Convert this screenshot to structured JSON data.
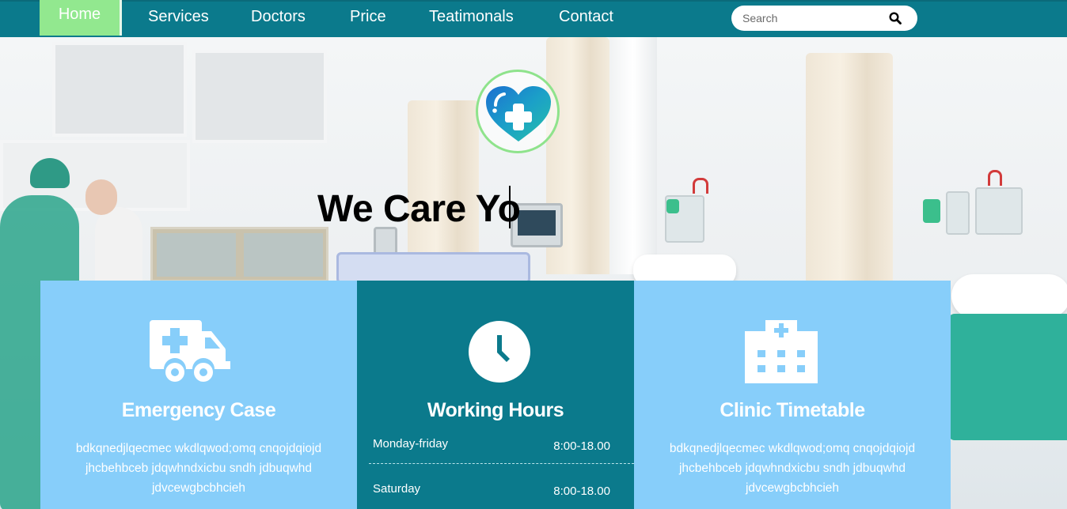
{
  "nav": {
    "items": [
      {
        "label": "Home"
      },
      {
        "label": "Services"
      },
      {
        "label": "Doctors"
      },
      {
        "label": "Price"
      },
      {
        "label": "Teatimonals"
      },
      {
        "label": "Contact"
      }
    ],
    "search_placeholder": "Search",
    "active_color": "#92e88f",
    "bar_color": "#0b7a8c"
  },
  "hero": {
    "heading": "We Care Yo",
    "logo_icon": "heart-plus-icon"
  },
  "cards": {
    "emergency": {
      "icon": "ambulance-icon",
      "title": "Emergency Case",
      "text": "bdkqnedjlqecmec wkdlqwod;omq cnqojdqiojd jhcbehbceb jdqwhndxicbu sndh jdbuqwhd jdvcewgbcbhcieh"
    },
    "hours": {
      "icon": "clock-icon",
      "title": "Working Hours",
      "rows": [
        {
          "day": "Monday-friday",
          "time": "8:00-18.00"
        },
        {
          "day": "Saturday",
          "time": "8:00-18.00"
        }
      ]
    },
    "timetable": {
      "icon": "hospital-icon",
      "title": "Clinic Timetable",
      "text": "bdkqnedjlqecmec wkdlqwod;omq cnqojdqiojd jhcbehbceb jdqwhndxicbu sndh jdbuqwhd jdvcewgbcbhcieh"
    }
  },
  "colors": {
    "light_blue": "#87cefa",
    "teal": "#0b7a8c",
    "green_accent": "#8fe38c"
  }
}
